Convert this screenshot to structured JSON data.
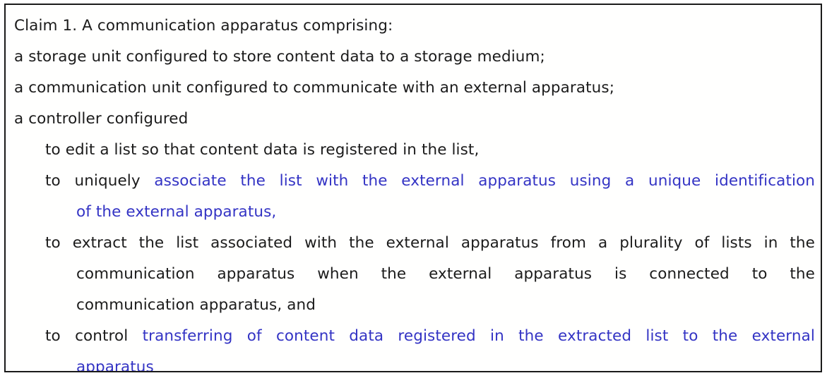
{
  "document": {
    "type": "patent-claim",
    "colors": {
      "text": "#1b1b1b",
      "highlight": "#3333c4",
      "border": "#1a1a1a",
      "background": "#fffffe"
    },
    "heading": "Claim 1. A communication apparatus comprising:",
    "lines": [
      {
        "id": "line-1",
        "indent": 0,
        "justified": false,
        "text": "Claim 1. A communication apparatus comprising:"
      },
      {
        "id": "line-2",
        "indent": 0,
        "justified": false,
        "text": "a storage unit configured to store content data to a storage medium;"
      },
      {
        "id": "line-3",
        "indent": 0,
        "justified": false,
        "text": "a communication unit configured to communicate with an external apparatus;"
      },
      {
        "id": "line-4",
        "indent": 0,
        "justified": false,
        "text": "a controller configured"
      },
      {
        "id": "line-5",
        "indent": 1,
        "justified": false,
        "text": "to edit a list so that content data is registered in the list,"
      },
      {
        "id": "line-6",
        "indent": 1,
        "justified": true,
        "words": [
          {
            "t": "to",
            "c": "black"
          },
          {
            "t": "uniquely",
            "c": "black"
          },
          {
            "t": "associate",
            "c": "blue"
          },
          {
            "t": "the",
            "c": "blue"
          },
          {
            "t": "list",
            "c": "blue"
          },
          {
            "t": "with",
            "c": "blue"
          },
          {
            "t": "the",
            "c": "blue"
          },
          {
            "t": "external",
            "c": "blue"
          },
          {
            "t": "apparatus",
            "c": "blue"
          },
          {
            "t": "using",
            "c": "blue"
          },
          {
            "t": "a",
            "c": "blue"
          },
          {
            "t": "unique",
            "c": "blue"
          },
          {
            "t": "identification",
            "c": "blue"
          }
        ]
      },
      {
        "id": "line-7",
        "indent": 2,
        "justified": false,
        "text": "of the external apparatus,",
        "color": "blue",
        "trailing_comma_black": true
      },
      {
        "id": "line-8",
        "indent": 1,
        "justified": true,
        "words": [
          {
            "t": "to",
            "c": "black"
          },
          {
            "t": "extract",
            "c": "black"
          },
          {
            "t": "the",
            "c": "black"
          },
          {
            "t": "list",
            "c": "black"
          },
          {
            "t": "associated",
            "c": "black"
          },
          {
            "t": "with",
            "c": "black"
          },
          {
            "t": "the",
            "c": "black"
          },
          {
            "t": "external",
            "c": "black"
          },
          {
            "t": "apparatus",
            "c": "black"
          },
          {
            "t": "from",
            "c": "black"
          },
          {
            "t": "a",
            "c": "black"
          },
          {
            "t": "plurality",
            "c": "black"
          },
          {
            "t": "of",
            "c": "black"
          },
          {
            "t": "lists",
            "c": "black"
          },
          {
            "t": "in",
            "c": "black"
          },
          {
            "t": "the",
            "c": "black"
          }
        ]
      },
      {
        "id": "line-9",
        "indent": 2,
        "justified": true,
        "words": [
          {
            "t": "communication",
            "c": "black"
          },
          {
            "t": "apparatus",
            "c": "black"
          },
          {
            "t": "when",
            "c": "black"
          },
          {
            "t": "the",
            "c": "black"
          },
          {
            "t": "external",
            "c": "black"
          },
          {
            "t": "apparatus",
            "c": "black"
          },
          {
            "t": "is",
            "c": "black"
          },
          {
            "t": "connected",
            "c": "black"
          },
          {
            "t": "to",
            "c": "black"
          },
          {
            "t": "the",
            "c": "black"
          }
        ]
      },
      {
        "id": "line-10",
        "indent": 2,
        "justified": false,
        "text": "communication apparatus, and"
      },
      {
        "id": "line-11",
        "indent": 1,
        "justified": true,
        "words": [
          {
            "t": "to",
            "c": "black"
          },
          {
            "t": "control",
            "c": "black"
          },
          {
            "t": "transferring",
            "c": "blue"
          },
          {
            "t": "of",
            "c": "blue"
          },
          {
            "t": "content",
            "c": "blue"
          },
          {
            "t": "data",
            "c": "blue"
          },
          {
            "t": "registered",
            "c": "blue"
          },
          {
            "t": "in",
            "c": "blue"
          },
          {
            "t": "the",
            "c": "blue"
          },
          {
            "t": "extracted",
            "c": "blue"
          },
          {
            "t": "list",
            "c": "blue"
          },
          {
            "t": "to",
            "c": "blue"
          },
          {
            "t": "the",
            "c": "blue"
          },
          {
            "t": "external",
            "c": "blue"
          }
        ]
      },
      {
        "id": "line-12",
        "indent": 2,
        "justified": false,
        "text": "apparatus",
        "color": "blue"
      }
    ]
  }
}
